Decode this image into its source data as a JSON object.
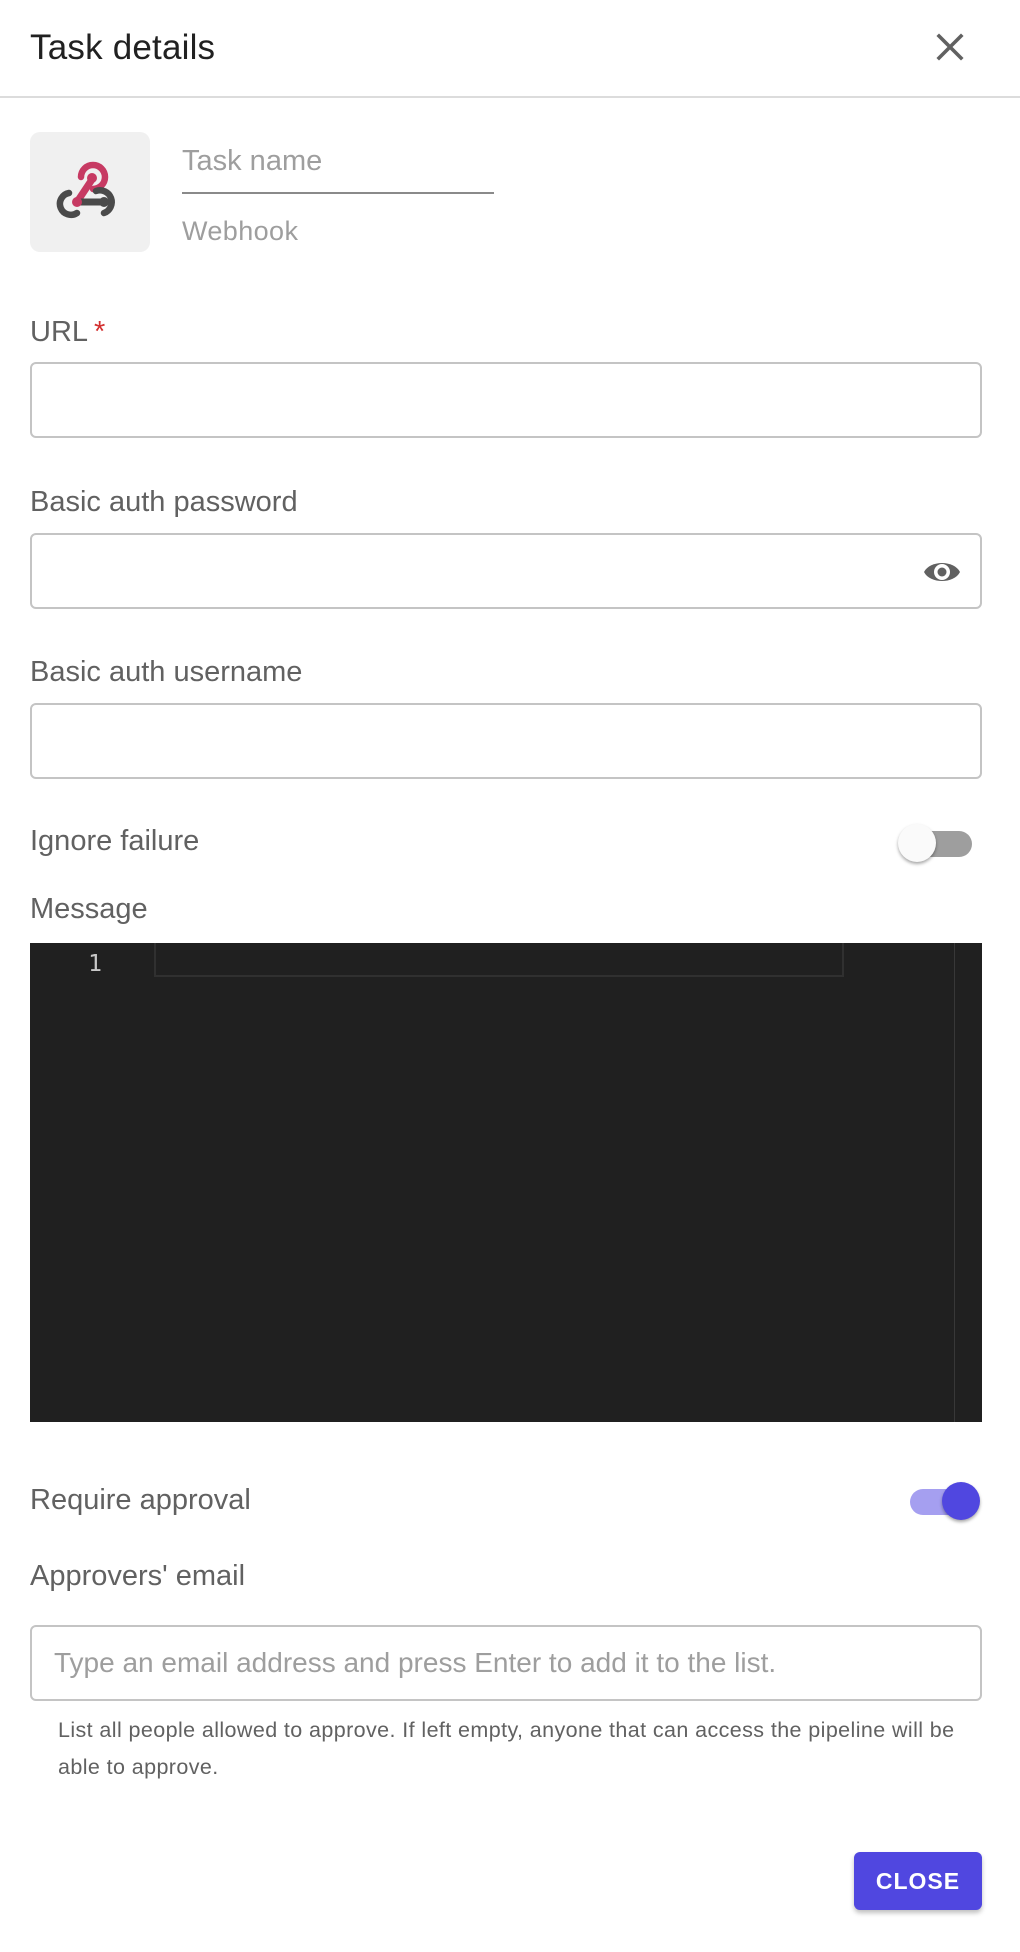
{
  "dialog": {
    "title": "Task details",
    "close_icon": "close-icon"
  },
  "task": {
    "icon": "webhook-icon",
    "name_value": "",
    "name_placeholder": "Task name",
    "type_label": "Webhook"
  },
  "fields": {
    "url": {
      "label": "URL",
      "required_mark": "*",
      "value": ""
    },
    "password": {
      "label": "Basic auth password",
      "value": "",
      "toggle_icon": "eye-icon"
    },
    "username": {
      "label": "Basic auth username",
      "value": ""
    }
  },
  "ignore_failure": {
    "label": "Ignore failure",
    "enabled": false
  },
  "message": {
    "label": "Message",
    "line_numbers": [
      "1"
    ],
    "content": ""
  },
  "require_approval": {
    "label": "Require approval",
    "enabled": true
  },
  "approvers": {
    "label": "Approvers' email",
    "value": "",
    "placeholder": "Type an email address and press Enter to add it to the list.",
    "helper": "List all people allowed to approve. If left empty, anyone that can access the pipeline will be able to approve."
  },
  "footer": {
    "close_label": "CLOSE"
  },
  "colors": {
    "accent": "#5047e0",
    "accent_light": "#a59ff0",
    "required": "#d32f2f",
    "editor_bg": "#202020",
    "webhook_red": "#c73a63",
    "webhook_dark": "#4a4a4a"
  }
}
